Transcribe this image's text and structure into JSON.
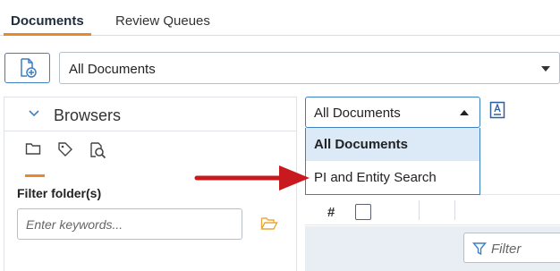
{
  "tabs": [
    {
      "label": "Documents",
      "active": true
    },
    {
      "label": "Review Queues",
      "active": false
    }
  ],
  "toolbar": {
    "new_document_icon": "file-plus-icon",
    "view_select_value": "All Documents"
  },
  "browsers": {
    "title": "Browsers",
    "icons": [
      "folder-icon",
      "tag-icon",
      "search-document-icon"
    ],
    "filter_label": "Filter folder(s)",
    "keyword_placeholder": "Enter keywords..."
  },
  "document_list": {
    "view_select": {
      "value": "All Documents",
      "options": [
        "All Documents",
        "PI and Entity Search"
      ],
      "selected": "All Documents"
    },
    "column_header_hash": "#",
    "filter_placeholder": "Filter"
  },
  "colors": {
    "accent_orange": "#e48a2b",
    "primary_blue": "#3d7fc1",
    "selected_row": "#dbeaf6",
    "annotation_red": "#c8191e",
    "folder_yellow": "#e8a93a"
  }
}
